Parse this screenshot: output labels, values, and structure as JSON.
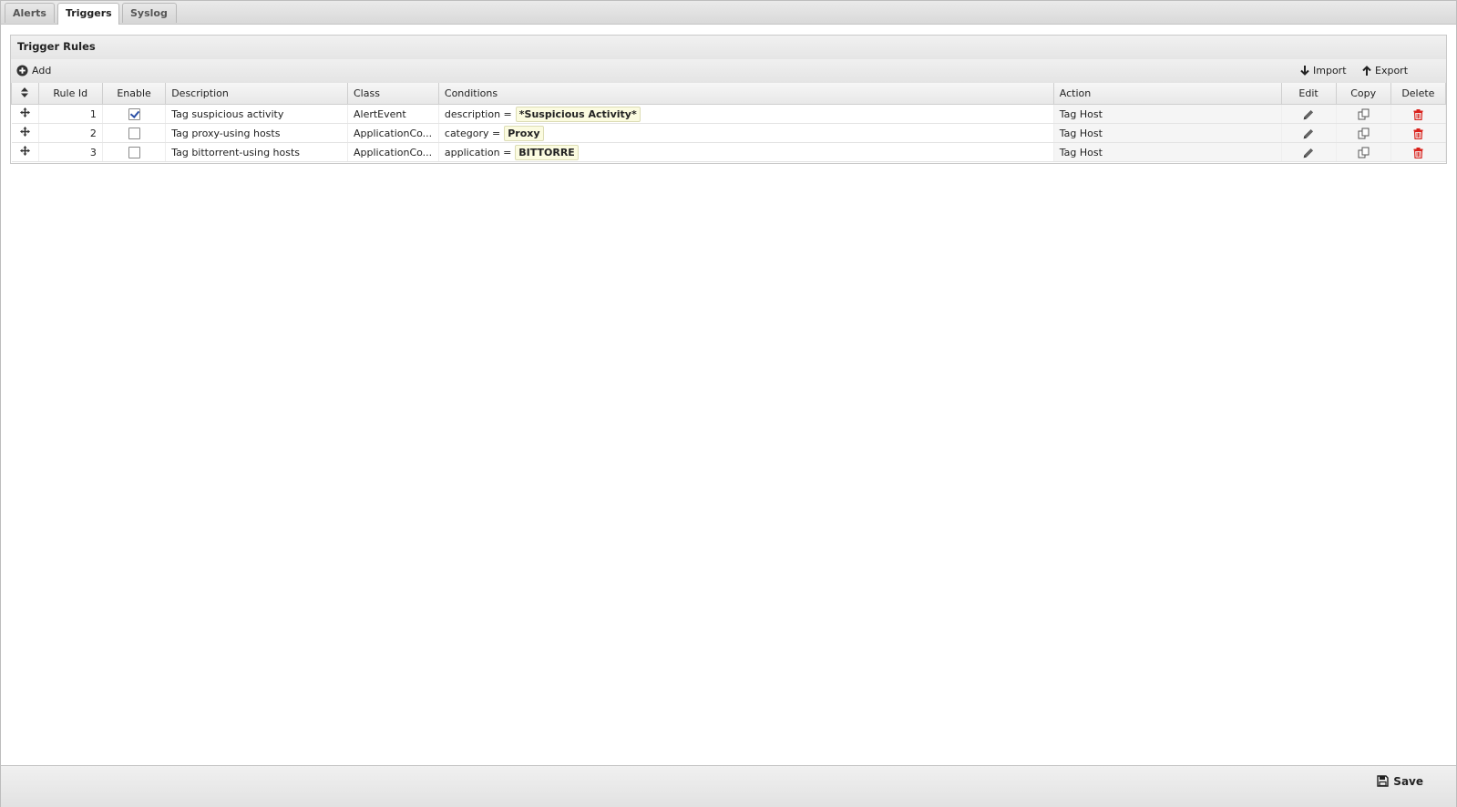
{
  "tabs": [
    {
      "label": "Alerts",
      "active": false
    },
    {
      "label": "Triggers",
      "active": true
    },
    {
      "label": "Syslog",
      "active": false
    }
  ],
  "panel": {
    "title": "Trigger Rules",
    "toolbar": {
      "add_label": "Add",
      "import_label": "Import",
      "export_label": "Export"
    }
  },
  "table": {
    "columns": [
      "",
      "Rule Id",
      "Enable",
      "Description",
      "Class",
      "Conditions",
      "Action",
      "Edit",
      "Copy",
      "Delete"
    ],
    "rows": [
      {
        "rule_id": "1",
        "enabled": true,
        "description": "Tag suspicious activity",
        "class": "AlertEvent",
        "condition_field": "description =",
        "condition_value": "*Suspicious Activity*",
        "action": "Tag Host"
      },
      {
        "rule_id": "2",
        "enabled": false,
        "description": "Tag proxy-using hosts",
        "class": "ApplicationCo...",
        "condition_field": "category =",
        "condition_value": "Proxy",
        "action": "Tag Host"
      },
      {
        "rule_id": "3",
        "enabled": false,
        "description": "Tag bittorrent-using hosts",
        "class": "ApplicationCo...",
        "condition_field": "application =",
        "condition_value": "BITTORRE",
        "action": "Tag Host"
      }
    ]
  },
  "footer": {
    "save_label": "Save"
  },
  "colors": {
    "delete": "#d9231d",
    "icon": "#555555"
  }
}
